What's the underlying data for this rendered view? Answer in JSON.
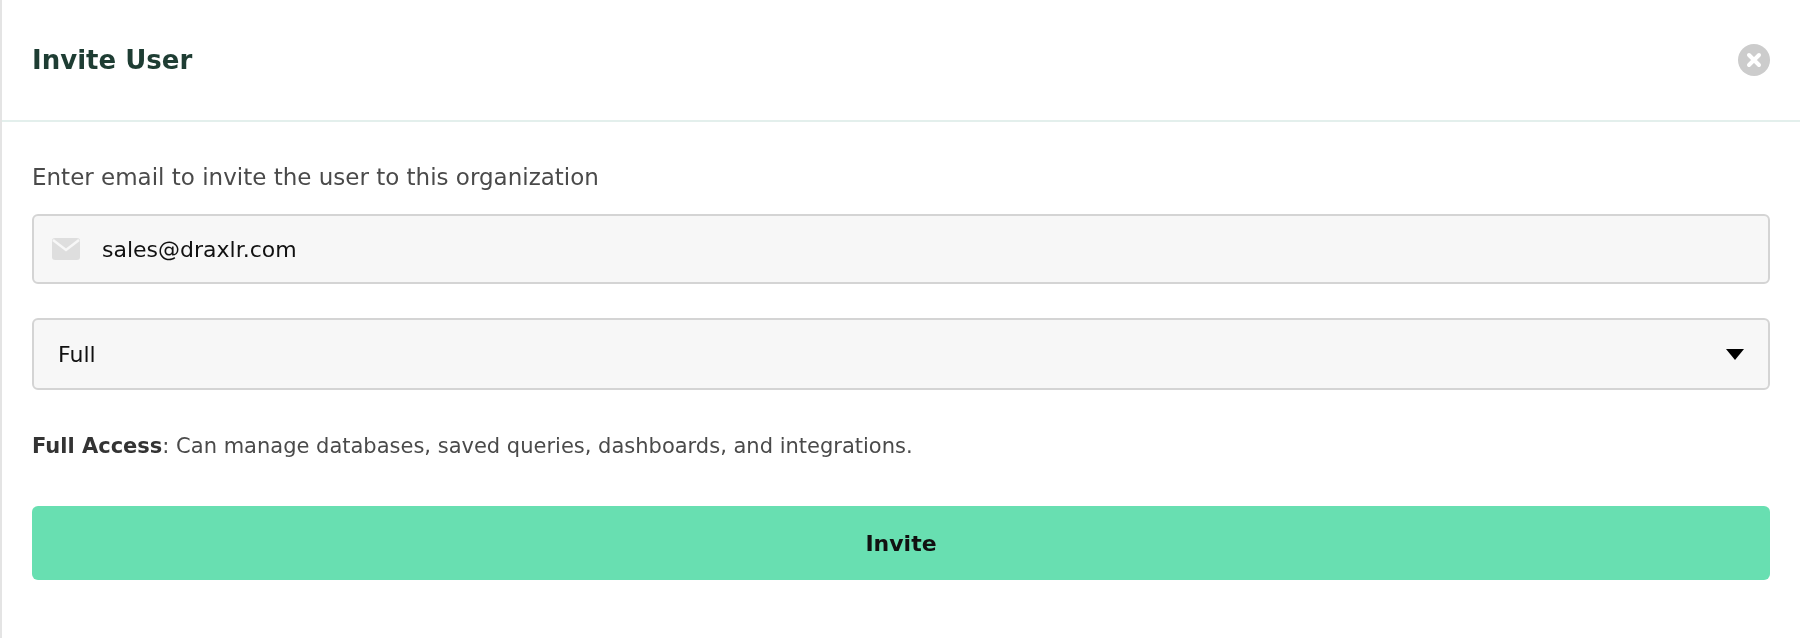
{
  "dialog": {
    "title": "Invite User"
  },
  "form": {
    "label": "Enter email to invite the user to this organization",
    "email": {
      "value": "sales@draxlr.com"
    },
    "access": {
      "value": "Full"
    },
    "description": "**Full Access**: Can manage databases, saved queries, dashboards, and integrations."
  },
  "buttons": [
    {
      "label": "Invite"
    }
  ]
}
